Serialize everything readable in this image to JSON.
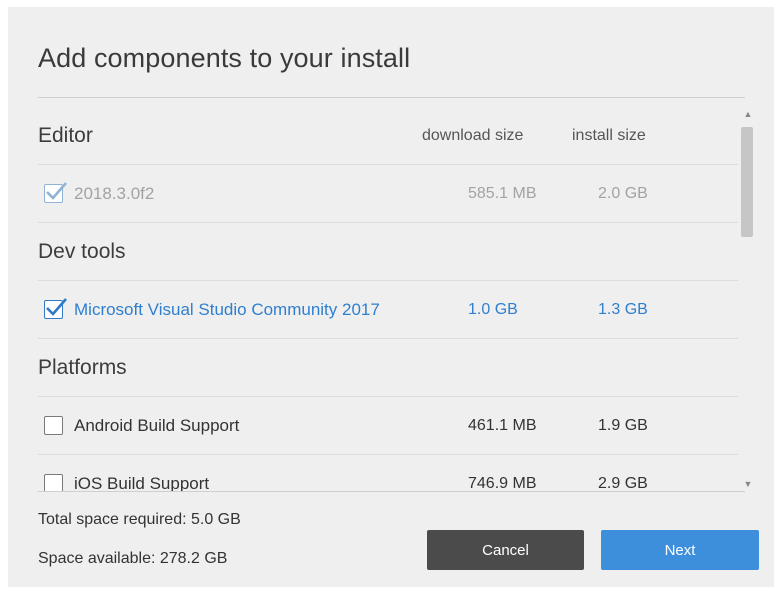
{
  "dialog": {
    "title": "Add components to your install"
  },
  "columns": {
    "download": "download size",
    "install": "install size"
  },
  "sections": {
    "editor": {
      "heading": "Editor",
      "items": [
        {
          "label": "2018.3.0f2",
          "download": "585.1 MB",
          "install": "2.0 GB",
          "checked": true,
          "disabled": true
        }
      ]
    },
    "devtools": {
      "heading": "Dev tools",
      "items": [
        {
          "label": "Microsoft Visual Studio Community 2017",
          "download": "1.0 GB",
          "install": "1.3 GB",
          "checked": true,
          "disabled": false
        }
      ]
    },
    "platforms": {
      "heading": "Platforms",
      "items": [
        {
          "label": "Android Build Support",
          "download": "461.1 MB",
          "install": "1.9 GB",
          "checked": false,
          "disabled": false
        },
        {
          "label": "iOS Build Support",
          "download": "746.9 MB",
          "install": "2.9 GB",
          "checked": false,
          "disabled": false
        }
      ]
    }
  },
  "footer": {
    "total": "Total space required: 5.0 GB",
    "available": "Space available: 278.2 GB",
    "cancel_label": "Cancel",
    "next_label": "Next"
  },
  "colors": {
    "accent": "#3d8fdc",
    "link": "#2f7fcf",
    "cancel": "#4b4b4b"
  }
}
